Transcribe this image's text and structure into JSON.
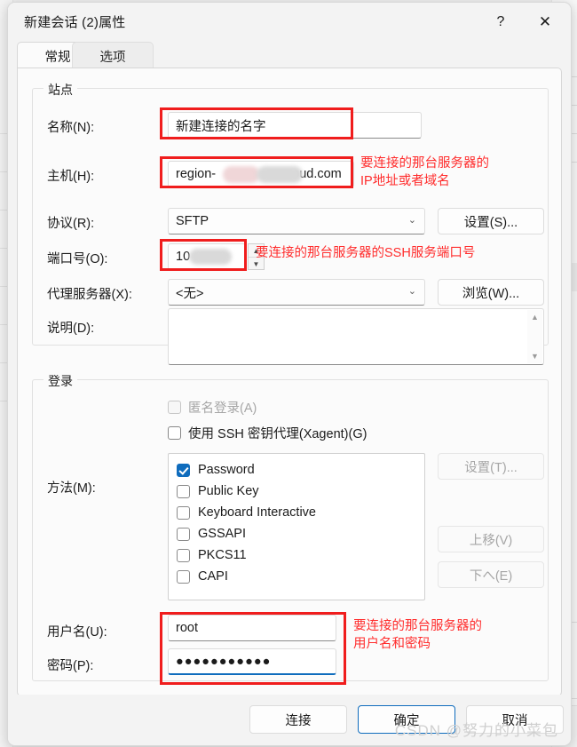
{
  "window": {
    "title": "新建会话 (2)属性",
    "help_icon": "?",
    "close_icon": "✕"
  },
  "tabs": [
    {
      "label": "常规",
      "active": true
    },
    {
      "label": "选项",
      "active": false
    }
  ],
  "site_group": {
    "title": "站点",
    "name_label": "名称(N):",
    "name_value": "新建连接的名字",
    "host_label": "主机(H):",
    "host_value_prefix": "region-",
    "host_value_suffix": "oud.com",
    "protocol_label": "协议(R):",
    "protocol_value": "SFTP",
    "protocol_settings_button": "设置(S)...",
    "port_label": "端口号(O):",
    "port_value": "10",
    "proxy_label": "代理服务器(X):",
    "proxy_value": "<无>",
    "proxy_browse_button": "浏览(W)...",
    "description_label": "说明(D):",
    "description_value": "",
    "spinner_up": "▲",
    "spinner_down": "▼",
    "scroll_up": "▲",
    "scroll_down": "▼",
    "chevron": "⌄"
  },
  "login_group": {
    "title": "登录",
    "anonymous_label": "匿名登录(A)",
    "anonymous_checked": false,
    "anonymous_disabled": true,
    "xagent_label": "使用 SSH 密钥代理(Xagent)(G)",
    "xagent_checked": false,
    "method_label": "方法(M):",
    "methods": [
      {
        "label": "Password",
        "checked": true
      },
      {
        "label": "Public Key",
        "checked": false
      },
      {
        "label": "Keyboard Interactive",
        "checked": false
      },
      {
        "label": "GSSAPI",
        "checked": false
      },
      {
        "label": "PKCS11",
        "checked": false
      },
      {
        "label": "CAPI",
        "checked": false
      }
    ],
    "method_settings_button": "设置(T)...",
    "move_up_button": "上移(V)",
    "move_down_button": "下へ(E)",
    "username_label": "用户名(U):",
    "username_value": "root",
    "password_label": "密码(P):",
    "password_value": "●●●●●●●●●●●"
  },
  "annotations": [
    {
      "text": "要连接的那台服务器的\nIP地址或者域名"
    },
    {
      "text": "要连接的那台服务器的SSH服务端口号"
    },
    {
      "text": "要连接的那台服务器的\n用户名和密码"
    }
  ],
  "footer": {
    "connect_button": "连接",
    "ok_button": "确定",
    "cancel_button": "取消"
  },
  "watermark": "CSDN @努力的小菜包",
  "colors": {
    "accent": "#0f6cbd",
    "annotation_red": "#ff2d2d",
    "highlight_box": "#f01d1d",
    "dialog_bg": "#f3f3f3",
    "panel_bg": "#fbfbfb"
  }
}
